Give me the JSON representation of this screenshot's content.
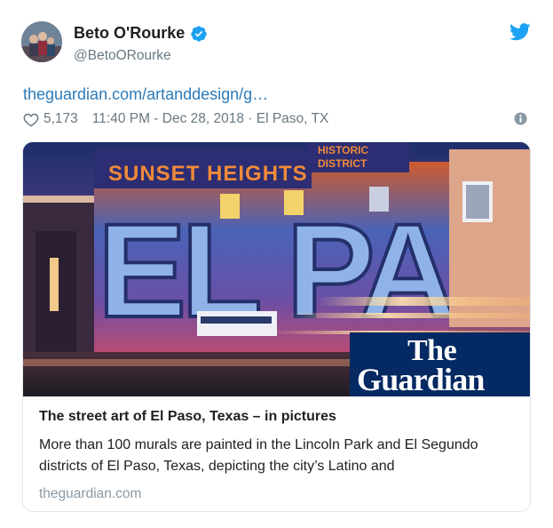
{
  "tweet": {
    "author": {
      "name": "Beto O'Rourke",
      "handle": "@BetoORourke",
      "verified": true
    },
    "link_text": "theguardian.com/artanddesign/g…",
    "likes": "5,173",
    "timestamp": "11:40 PM - Dec 28, 2018 · El Paso, TX",
    "icons": [
      "twitter-bird-icon",
      "verified-badge-icon",
      "heart-icon",
      "info-icon"
    ],
    "colors": {
      "link": "#2b7bb9",
      "secondary_text": "#697882",
      "verified_blue": "#1da1f2",
      "guardian_navy": "#052962"
    }
  },
  "card": {
    "image": {
      "mural_words": {
        "sunset": "SUNSET HEIGHTS",
        "historic": "HISTORIC",
        "district": "DISTRICT",
        "city": "EL PASO"
      },
      "logo": {
        "the": "The",
        "name": "Guardian"
      }
    },
    "title": "The street art of El Paso, Texas – in pictures",
    "description": "More than 100 murals are painted in the Lincoln Park and El Segundo districts of El Paso, Texas, depicting the city’s Latino and",
    "domain": "theguardian.com"
  }
}
